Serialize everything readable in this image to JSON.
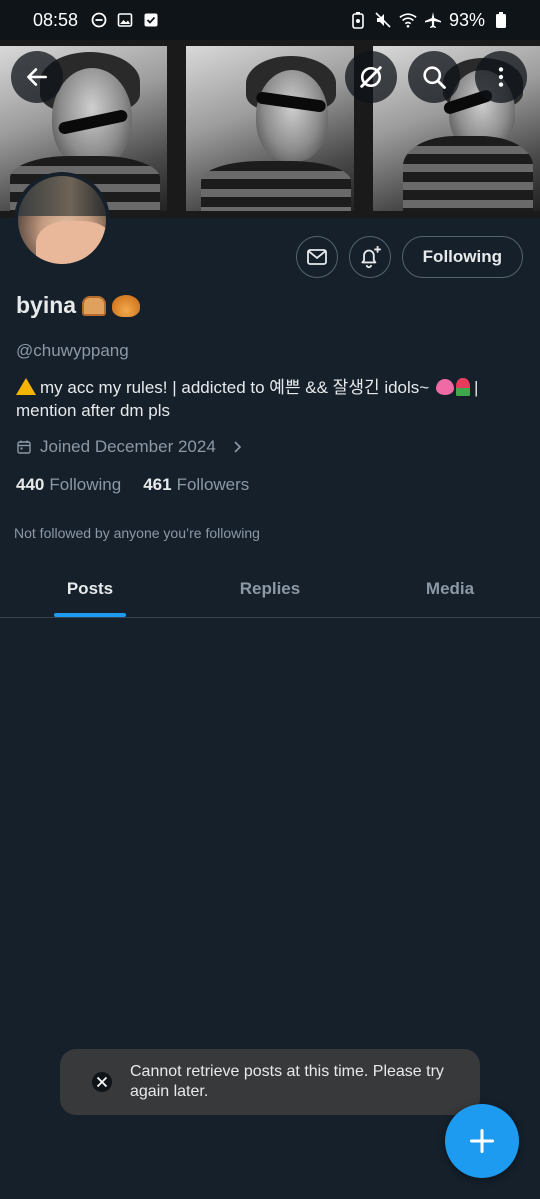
{
  "status_bar": {
    "time": "08:58",
    "battery": "93%"
  },
  "profile": {
    "display_name": "byina",
    "handle": "@chuwyppang",
    "bio_part1": "my acc my rules! | addicted to 예쁜 && 잘생긴 idols~",
    "bio_part2": "|",
    "bio_line2": "mention after dm pls",
    "joined": "Joined December 2024",
    "following_count": "440",
    "following_label": "Following",
    "followers_count": "461",
    "followers_label": "Followers",
    "not_followed_note": "Not followed by anyone you’re following"
  },
  "actions": {
    "following_button": "Following"
  },
  "tabs": [
    {
      "label": "Posts",
      "active": true
    },
    {
      "label": "Replies",
      "active": false
    },
    {
      "label": "Media",
      "active": false
    }
  ],
  "toast": {
    "message": "Cannot retrieve posts at this time. Please try again later."
  },
  "icons": {
    "back": "arrow-left-icon",
    "grok": "grok-icon",
    "search": "search-icon",
    "more": "more-vertical-icon",
    "message": "envelope-icon",
    "notify": "bell-plus-icon",
    "calendar": "calendar-icon",
    "compose": "plus-icon"
  },
  "colors": {
    "background": "#15202b",
    "accent": "#1d9bf0",
    "secondary_text": "#8b98a5"
  }
}
